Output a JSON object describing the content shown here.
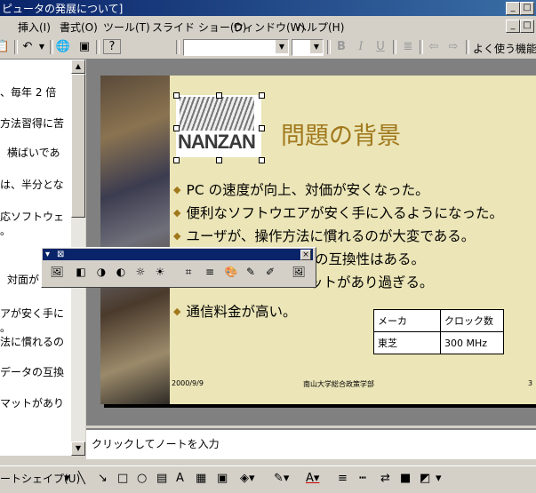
{
  "window": {
    "title": "ピュータの発展について]"
  },
  "menu": {
    "items": [
      "挿入(I)",
      "書式(O)",
      "ツール(T)",
      "スライド ショー(D)",
      "ウィンドウ(W)",
      "ヘルプ(H)"
    ]
  },
  "toolbar": {
    "frequent_label": "よく使う機能(C"
  },
  "outline": {
    "lines": [
      "、毎年 2 倍",
      "方法習得に苦",
      "横ばいであ",
      "は、半分とな",
      "応ソフトウェ",
      "。",
      "対面が",
      "アが安く手に",
      "。",
      "法に慣れるの",
      "データの互換",
      "マットがあり"
    ]
  },
  "slide": {
    "logo_text": "NANZAN",
    "title": "問題の背景",
    "bullets": [
      "PC の速度が向上、対価が安くなった。",
      "便利なソフトウエアが安く手に入るようになった。",
      "ユーザが、操作方法に慣れるのが大変である。",
      "ータの互換性はある。",
      "ットがあり過ぎる。",
      "通信料金が高い。"
    ],
    "table": {
      "headers": [
        "メーカ",
        "クロック数"
      ],
      "rows": [
        [
          "東芝",
          "300 MHz"
        ]
      ]
    },
    "footer_date": "2000/9/9",
    "footer_org": "南山大学総合政策学部",
    "footer_page": "3"
  },
  "notes": {
    "placeholder": "クリックしてノートを入力"
  },
  "drawing_toolbar": {
    "autoshape_label": "ートシェイプ(U)"
  },
  "icons": {
    "minimize": "minimize-icon",
    "close": "close-icon",
    "scroll_up": "scroll-up-icon",
    "scroll_down": "scroll-down-icon"
  },
  "colors": {
    "title_gold": "#a0781c",
    "titlebar_blue": "#0a246a",
    "slide_bg": "#ebe5b7"
  }
}
